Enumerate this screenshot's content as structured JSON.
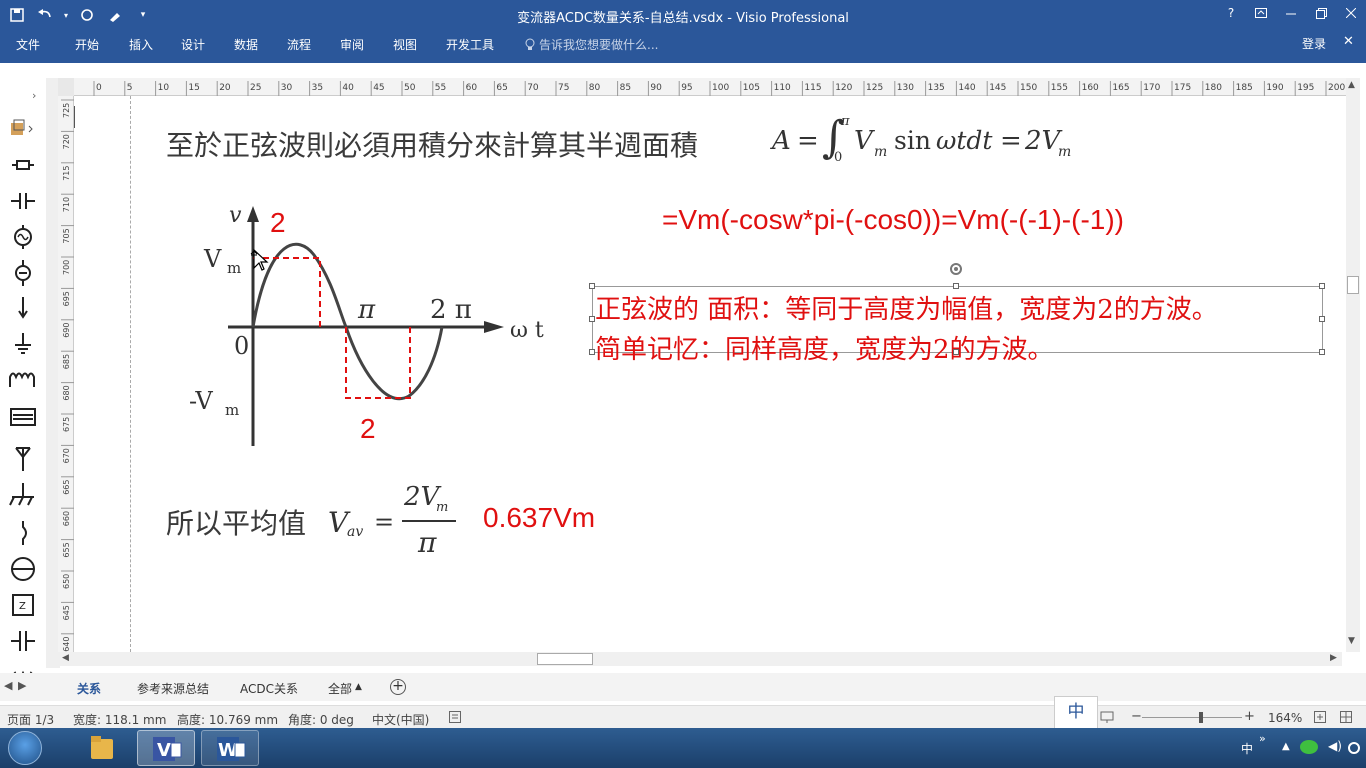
{
  "window": {
    "title": "变流器ACDC数量关系-自总结.vsdx - Visio Professional",
    "help": "?"
  },
  "ribbon": {
    "tabs": [
      "文件",
      "开始",
      "插入",
      "设计",
      "数据",
      "流程",
      "审阅",
      "视图",
      "开发工具"
    ],
    "tell_me": "告诉我您想要做什么...",
    "login": "登录"
  },
  "hruler": {
    "ticks": [
      "0",
      "5",
      "10",
      "15",
      "20",
      "25",
      "30",
      "35",
      "40",
      "45",
      "50",
      "55",
      "60",
      "65",
      "70",
      "75",
      "80",
      "85",
      "90",
      "95",
      "100",
      "105",
      "110",
      "115",
      "120",
      "125",
      "130",
      "135",
      "140",
      "145",
      "150",
      "155",
      "160",
      "165",
      "170",
      "175",
      "180",
      "185",
      "190",
      "195",
      "200"
    ]
  },
  "vruler": {
    "ticks": [
      "725",
      "720",
      "715",
      "710",
      "705",
      "700",
      "695",
      "690",
      "685",
      "680",
      "675",
      "670",
      "665",
      "660",
      "655",
      "650",
      "645",
      "640"
    ]
  },
  "leftpanel": {
    "icons": [
      "more-shapes-icon",
      "resistor-icon",
      "capacitor-icon",
      "ac-source-icon",
      "lamp-icon",
      "ground-icon",
      "earth-icon",
      "inductor-icon",
      "transformer-icon",
      "antenna-icon",
      "chassis-ground-icon",
      "switch-icon",
      "circle-icon",
      "zener-icon",
      "capacitor-2-icon",
      "wave-icon"
    ]
  },
  "page": {
    "heading": "至於正弦波則必須用積分來計算其半週面積",
    "integral": {
      "A": "A",
      "eq": "=",
      "upper": "π",
      "lower": "0",
      "Vm": "V",
      "m": "m",
      "sin": "sin",
      "wtdt": "ωtdt",
      "eq2": "=",
      "result": "2V",
      "result_sub": "m"
    },
    "formula_red": "=Vm(-cosw*pi-(-cos0))=Vm(-(-1)-(-1))",
    "note_line1": "正弦波的 面积：等同于高度为幅值，宽度为2的方波。",
    "note_line2": "简单记忆：同样高度，宽度为2的方波。",
    "graph": {
      "v": "v",
      "Vm": "V",
      "m": "m",
      "negVm": "-V",
      "zero": "0",
      "pi": "π",
      "twopi": "2 π",
      "wt": "ω t",
      "two_top": "2",
      "two_bottom": "2"
    },
    "avg": {
      "label": "所以平均值",
      "V": "V",
      "av": "av",
      "eq": "=",
      "num": "2V",
      "num_sub": "m",
      "den": "π",
      "value": "0.637Vm"
    }
  },
  "sheets": {
    "tabs": [
      "关系",
      "参考来源总结",
      "ACDC关系",
      "全部"
    ],
    "active": "关系"
  },
  "status": {
    "page": "页面 1/3",
    "width": "宽度: 118.1 mm",
    "height": "高度: 10.769 mm",
    "angle": "角度: 0 deg",
    "lang": "中文(中国)",
    "zoom": "164%",
    "ime": "中"
  },
  "taskbar": {
    "ime": "中",
    "expand": "»"
  }
}
